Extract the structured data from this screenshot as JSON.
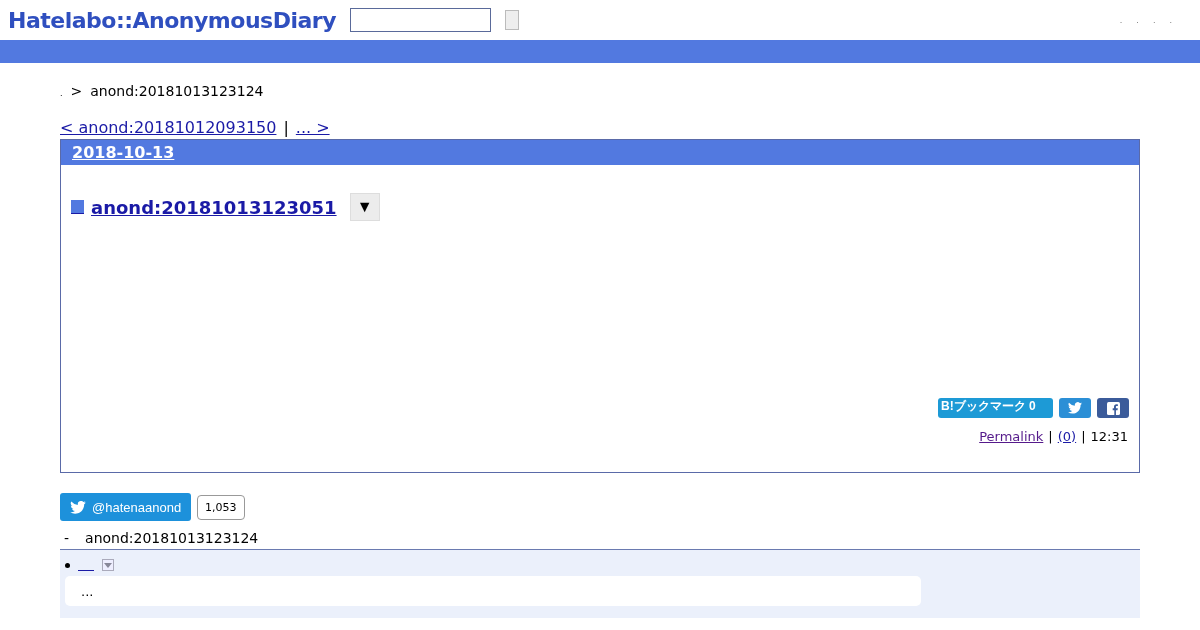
{
  "header": {
    "logo": "Hatelabo::AnonymousDiary",
    "links": [
      ".",
      ".",
      ".",
      "."
    ]
  },
  "breadcrumb": {
    "home": ".",
    "separator": ">",
    "current": "anond:20181013123124"
  },
  "pager": {
    "prev": "< anond:20181012093150",
    "separator": "|",
    "next": "... >"
  },
  "section": {
    "date": "2018-10-13",
    "title": "anond:20181013123051",
    "menu_button": "▼",
    "bookmark_button": "B!ブックマーク 0",
    "footer": {
      "permalink": "Permalink",
      "sep1": "|",
      "comments": "(0)",
      "sep2": "|",
      "time": "12:31"
    }
  },
  "follow": {
    "handle": "@hatenaanond",
    "count": "1,053"
  },
  "trackback": {
    "dash": "-",
    "title": "anond:20181013123124",
    "items": [
      {
        "excerpt": "..."
      }
    ]
  }
}
